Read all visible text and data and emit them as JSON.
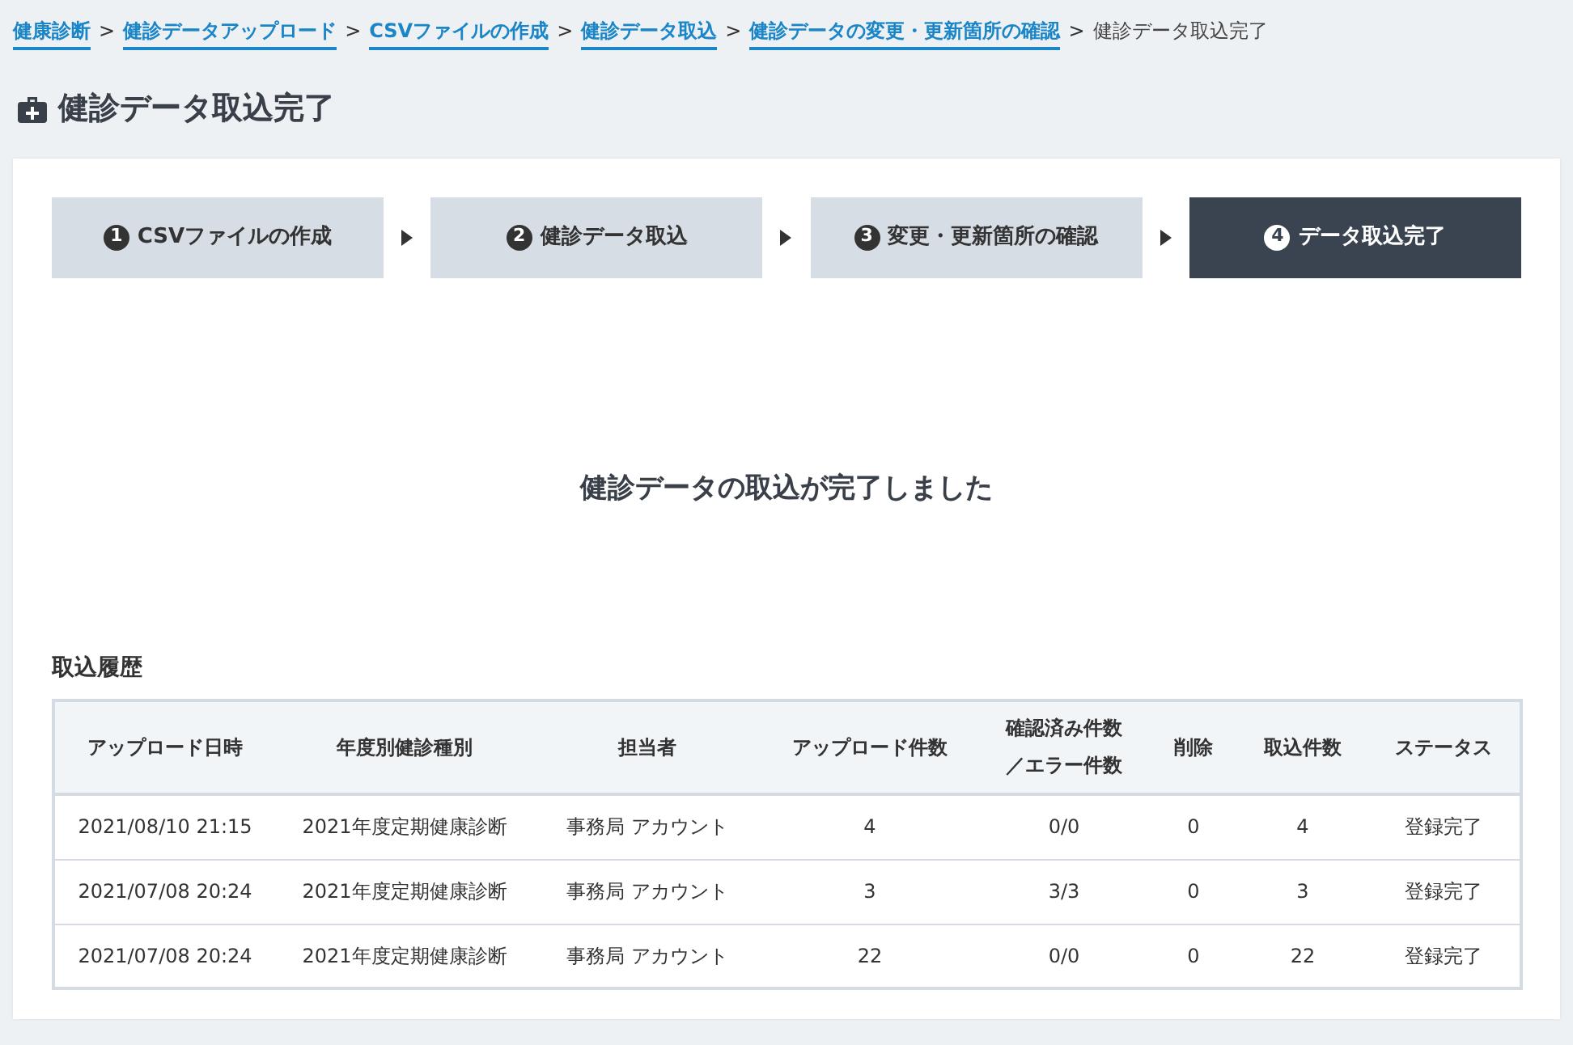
{
  "breadcrumb": [
    {
      "label": "健康診断",
      "current": false
    },
    {
      "label": "健診データアップロード",
      "current": false
    },
    {
      "label": "CSVファイルの作成",
      "current": false
    },
    {
      "label": "健診データ取込",
      "current": false
    },
    {
      "label": "健診データの変更・更新箇所の確認",
      "current": false
    },
    {
      "label": "健診データ取込完了",
      "current": true
    }
  ],
  "separator": ">",
  "page_title": "健診データ取込完了",
  "steps": [
    {
      "number": "1",
      "label": "CSVファイルの作成",
      "selected": false
    },
    {
      "number": "2",
      "label": "健診データ取込",
      "selected": false
    },
    {
      "number": "3",
      "label": "変更・更新箇所の確認",
      "selected": false
    },
    {
      "number": "4",
      "label": "データ取込完了",
      "selected": true
    }
  ],
  "message": "健診データの取込が完了しました",
  "history": {
    "title": "取込履歴",
    "columns": [
      "アップロード日時",
      "年度別健診種別",
      "担当者",
      "アップロード件数",
      "確認済み件数／エラー件数",
      "削除",
      "取込件数",
      "ステータス"
    ],
    "rows": [
      [
        "2021/08/10 21:15",
        "2021年度定期健康診断",
        "事務局 アカウント",
        "4",
        "0/0",
        "0",
        "4",
        "登録完了"
      ],
      [
        "2021/07/08 20:24",
        "2021年度定期健康診断",
        "事務局 アカウント",
        "3",
        "3/3",
        "0",
        "3",
        "登録完了"
      ],
      [
        "2021/07/08 20:24",
        "2021年度定期健康診断",
        "事務局 アカウント",
        "22",
        "0/0",
        "0",
        "22",
        "登録完了"
      ]
    ]
  }
}
